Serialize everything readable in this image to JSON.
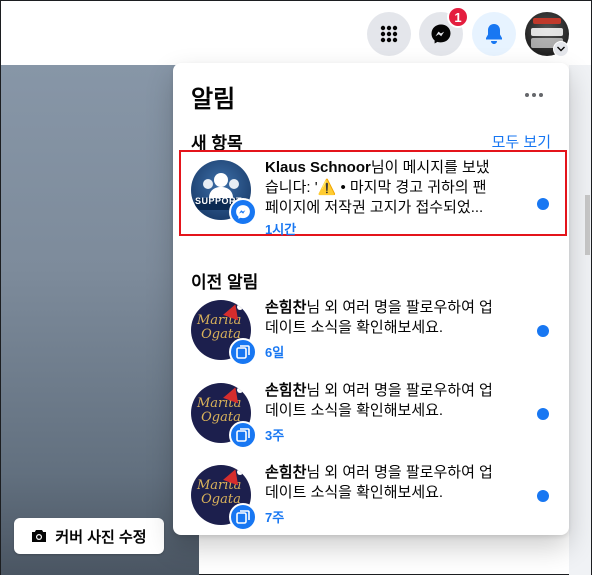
{
  "header": {
    "notification_badge": "1",
    "icons": [
      "apps-grid-icon",
      "messenger-icon",
      "bell-icon",
      "profile-avatar",
      "chevron-down-icon"
    ]
  },
  "cover": {
    "edit_label": "커버 사진 수정"
  },
  "panel": {
    "title": "알림",
    "new_section": "새 항목",
    "see_all": "모두 보기",
    "earlier_section": "이전 알림"
  },
  "notifications": [
    {
      "actor": "Klaus Schnoor",
      "text": "님이 메시지를 보냈습니다: '⚠️ • 마지막 경고 귀하의 팬페이지에 저작권 고지가 접수되었...",
      "text_line1_rest": "님이 메시지를 보냈",
      "text_line2": "습니다: '⚠️ • 마지막 경고 귀하의 팬",
      "text_line3": "페이지에 저작권 고지가 접수되었...",
      "time": "1시간",
      "avatar_text": "SUPPORT",
      "unread": true
    },
    {
      "actor": "손힘찬",
      "text_line1_rest": "님 외 여러 명을 팔로우하여 업",
      "text_line2": "데이트 소식을 확인해보세요.",
      "time": "6일",
      "unread": true
    },
    {
      "actor": "손힘찬",
      "text_line1_rest": "님 외 여러 명을 팔로우하여 업",
      "text_line2": "데이트 소식을 확인해보세요.",
      "time": "3주",
      "unread": true
    },
    {
      "actor": "손힘찬",
      "text_line1_rest": "님 외 여러 명을 팔로우하여 업",
      "text_line2": "데이트 소식을 확인해보세요.",
      "time": "7주",
      "unread": true
    }
  ],
  "colors": {
    "accent": "#1877f2",
    "badge": "#e41e3f",
    "highlight_border": "#e4141b"
  }
}
